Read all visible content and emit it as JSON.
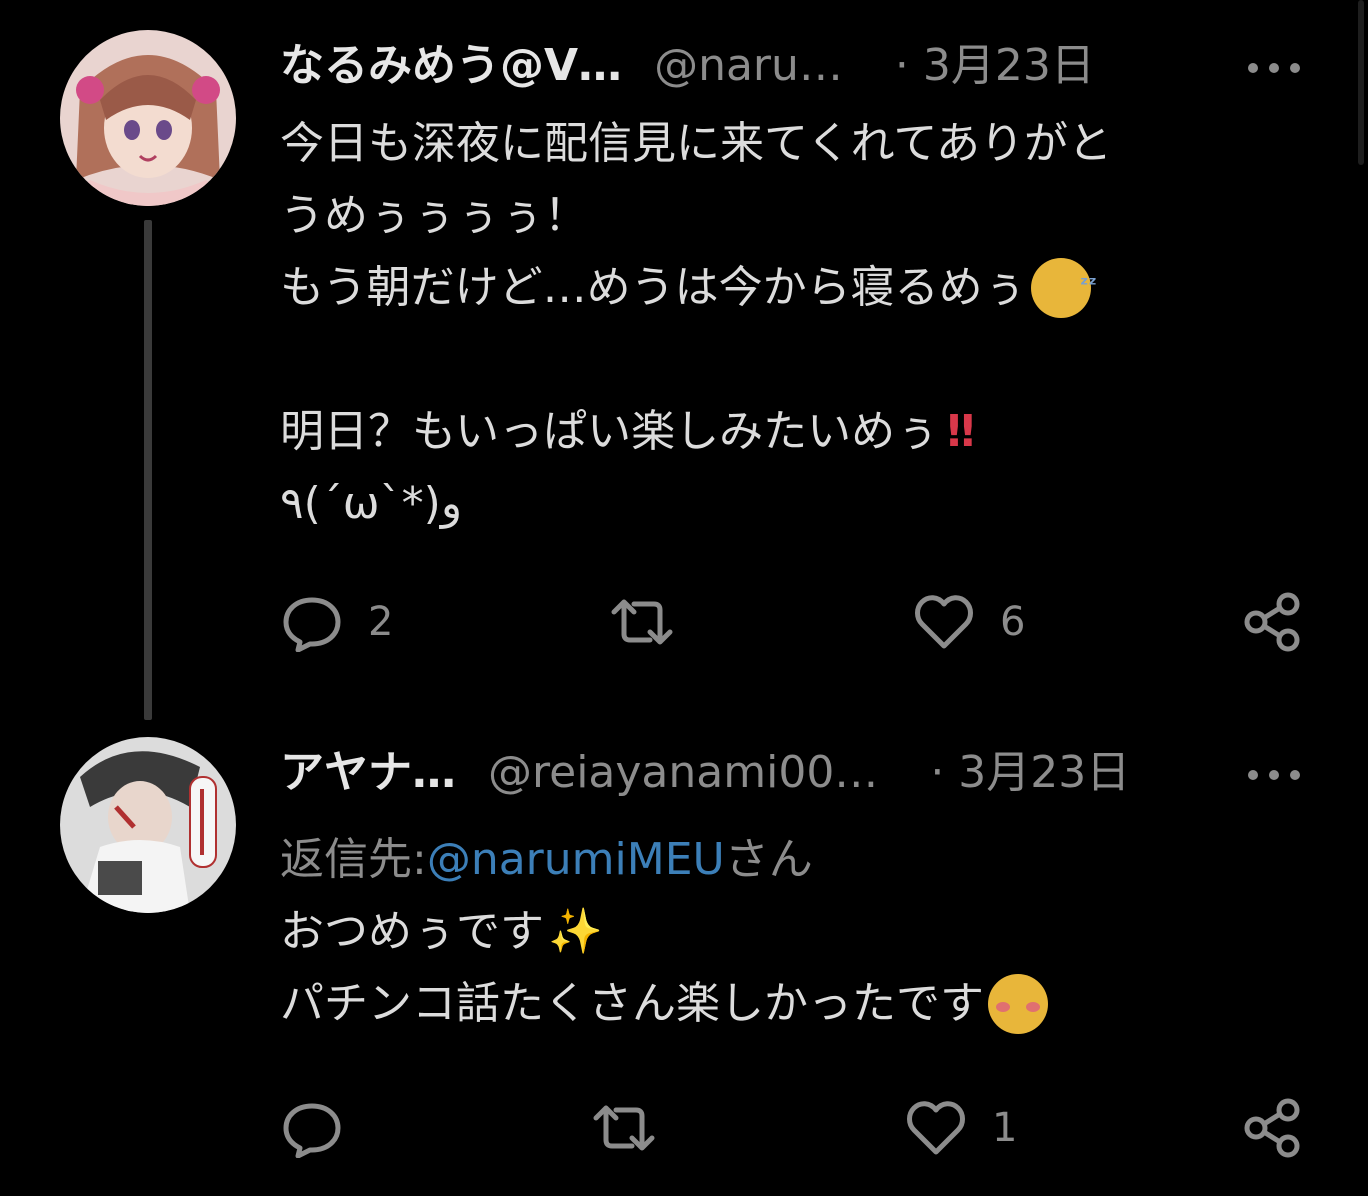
{
  "tweets": [
    {
      "display_name": "なるみめう@V…",
      "handle": "@naru…",
      "date": "· 3月23日",
      "lines": [
        "今日も深夜に配信見に来てくれてありがと",
        "うめぅぅぅぅ！",
        "もう朝だけど…めうは今から寝るめぅ",
        "",
        "明日？もいっぱい楽しみたいめぅ",
        "٩(´ω`*)و"
      ],
      "emoji": {
        "sleeping": "sleeping-face-icon",
        "exclaim": "‼"
      },
      "reply_count": "2",
      "like_count": "6"
    },
    {
      "display_name": "アヤナ…",
      "handle": "@reiayanami00…",
      "date": "· 3月23日",
      "reply_to_prefix": "返信先: ",
      "reply_to_mention": "@narumiMEU",
      "reply_to_suffix": "さん",
      "lines": [
        "おつめぅです",
        "パチンコ話たくさん楽しかったです"
      ],
      "emoji": {
        "sparkles": "✨",
        "blush": "blushing-face-icon"
      },
      "like_count": "1"
    }
  ],
  "colors": {
    "background": "#000000",
    "text": "#dcdcdc",
    "muted": "#8c8c8c",
    "mention": "#3c7fb8"
  }
}
